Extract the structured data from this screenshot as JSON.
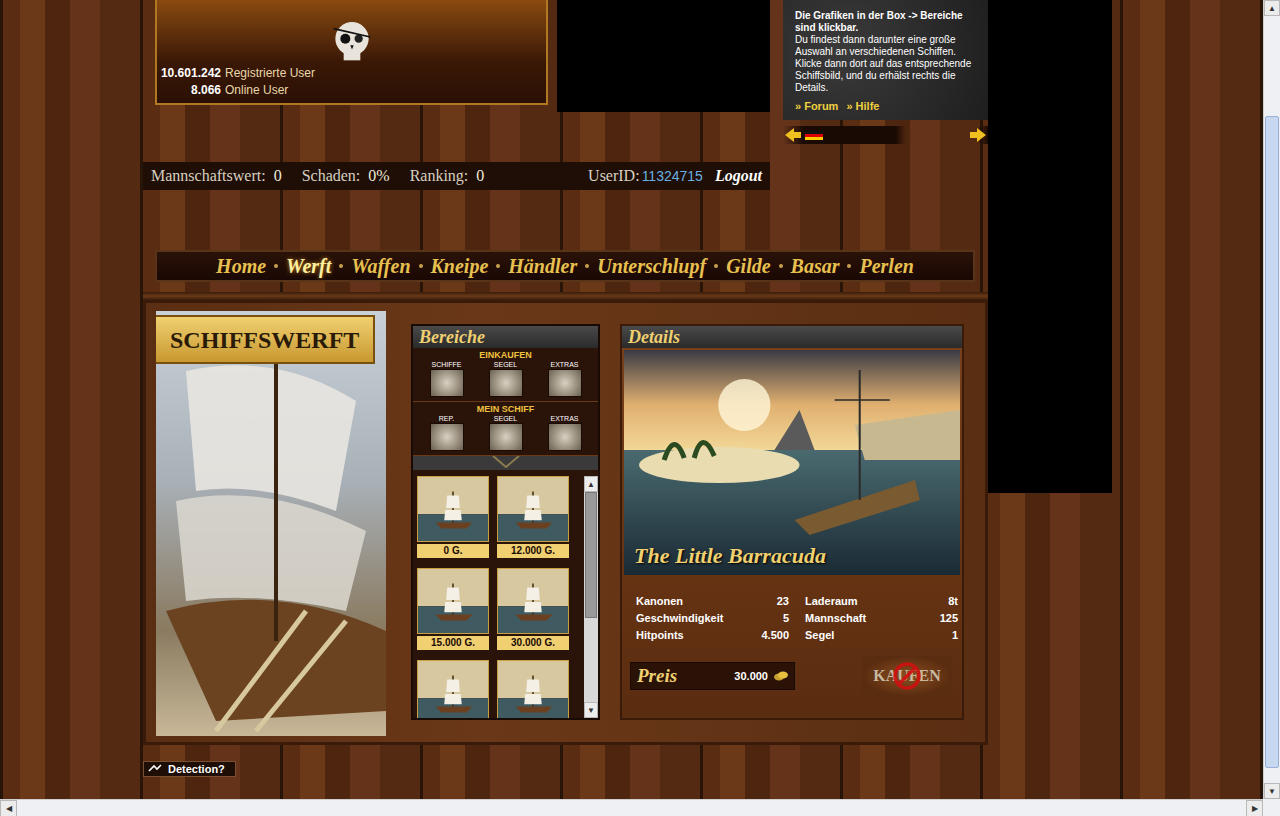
{
  "header": {
    "registered_count": "10.601.242",
    "registered_label": "Registrierte User",
    "online_count": "8.066",
    "online_label": "Online User"
  },
  "info_box": {
    "title": "Die Grafiken in der Box -> Bereiche sind klickbar.",
    "text": "Du findest dann darunter eine große Auswahl an verschiedenen Schiffen. Klicke dann dort auf das entsprechende Schiffsbild, und du erhälst rechts die Details.",
    "links": [
      "» Forum",
      "» Hilfe"
    ]
  },
  "stats_bar": {
    "items": [
      {
        "label": "Mannschaftswert:",
        "value": "0"
      },
      {
        "label": "Schaden:",
        "value": "0%"
      },
      {
        "label": "Ranking:",
        "value": "0"
      }
    ],
    "user_id_label": "UserID:",
    "user_id": "11324715",
    "logout": "Logout"
  },
  "nav": [
    {
      "label": "Home",
      "selected": false
    },
    {
      "label": "Werft",
      "selected": true
    },
    {
      "label": "Waffen",
      "selected": false
    },
    {
      "label": "Kneipe",
      "selected": false
    },
    {
      "label": "Händler",
      "selected": false
    },
    {
      "label": "Unterschlupf",
      "selected": false
    },
    {
      "label": "Gilde",
      "selected": false
    },
    {
      "label": "Basar",
      "selected": false
    },
    {
      "label": "Perlen",
      "selected": false
    }
  ],
  "shipyard": {
    "banner": "SCHIFFSWERFT"
  },
  "areas": {
    "title": "Bereiche",
    "groups": [
      {
        "title": "EINKAUFEN",
        "items": [
          "SCHIFFE",
          "SEGEL",
          "EXTRAS"
        ]
      },
      {
        "title": "MEIN SCHIFF",
        "items": [
          "REP.",
          "SEGEL",
          "EXTRAS"
        ]
      }
    ]
  },
  "ships": [
    {
      "price": "0 G.",
      "partial": false
    },
    {
      "price": "12.000 G.",
      "partial": false
    },
    {
      "price": "15.000 G.",
      "partial": false
    },
    {
      "price": "30.000 G.",
      "partial": false
    },
    {
      "partial": true
    },
    {
      "partial": true
    }
  ],
  "list_scroll": {
    "thumb_start": 0.0,
    "thumb_size": 0.6
  },
  "details": {
    "title": "Details",
    "ship_name": "The Little Barracuda",
    "stats": [
      {
        "label": "Kanonen",
        "value": "23"
      },
      {
        "label": "Laderaum",
        "value": "8t"
      },
      {
        "label": "Geschwindigkeit",
        "value": "5"
      },
      {
        "label": "Mannschaft",
        "value": "125"
      },
      {
        "label": "Hitpoints",
        "value": "4.500"
      },
      {
        "label": "Segel",
        "value": "1"
      }
    ],
    "price_label": "Preis",
    "price": "30.000",
    "buy": {
      "label": "KAUFEN",
      "disabled": true
    }
  },
  "detection": "Detection?",
  "page_scroll": {
    "thumb_start": 0.13,
    "thumb_size": 0.85
  }
}
